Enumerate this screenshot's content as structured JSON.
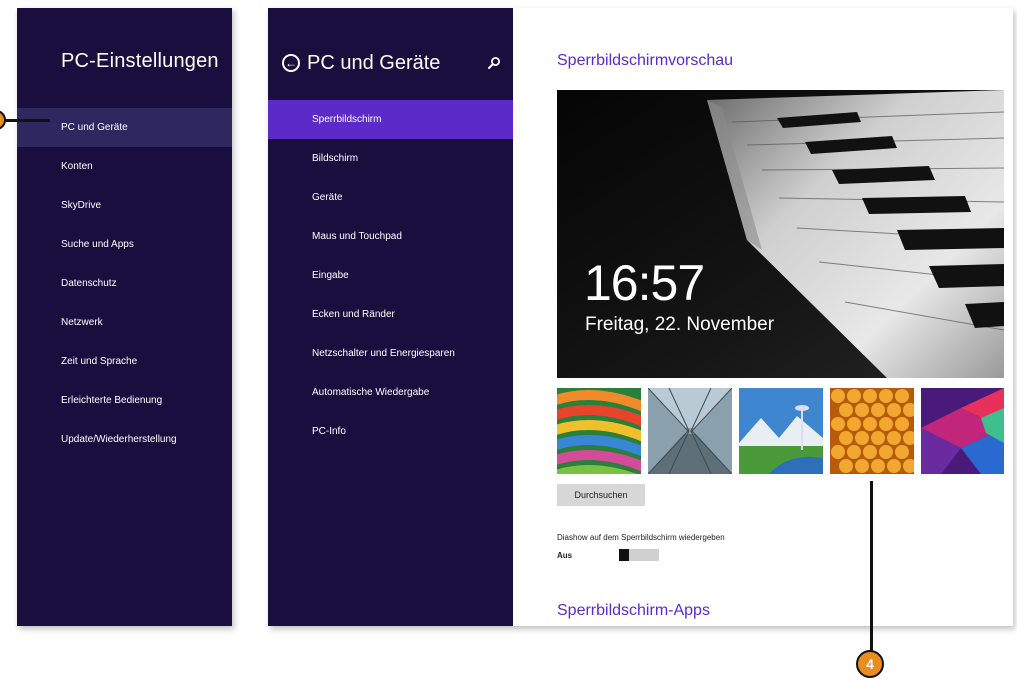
{
  "settings_panel": {
    "title": "PC-Einstellungen",
    "items": [
      {
        "label": "PC und Geräte",
        "active": true
      },
      {
        "label": "Konten"
      },
      {
        "label": "SkyDrive"
      },
      {
        "label": "Suche und Apps"
      },
      {
        "label": "Datenschutz"
      },
      {
        "label": "Netzwerk"
      },
      {
        "label": "Zeit und Sprache"
      },
      {
        "label": "Erleichterte Bedienung"
      },
      {
        "label": "Update/Wiederherstellung"
      }
    ]
  },
  "devices_panel": {
    "title": "PC und Geräte",
    "back_icon": "back-arrow-circle-icon",
    "search_icon": "search-icon",
    "items": [
      {
        "label": "Sperrbildschirm",
        "active": true
      },
      {
        "label": "Bildschirm"
      },
      {
        "label": "Geräte"
      },
      {
        "label": "Maus und Touchpad"
      },
      {
        "label": "Eingabe"
      },
      {
        "label": "Ecken und Ränder"
      },
      {
        "label": "Netzschalter und Energiesparen"
      },
      {
        "label": "Automatische Wiedergabe"
      },
      {
        "label": "PC-Info"
      }
    ]
  },
  "lockscreen": {
    "preview_heading": "Sperrbildschirmvorschau",
    "time": "16:57",
    "date": "Freitag, 22. November",
    "browse_button": "Durchsuchen",
    "slideshow_label": "Diashow auf dem Sperrbildschirm wiedergeben",
    "slideshow_state": "Aus",
    "slideshow_on": false,
    "apps_heading": "Sperrbildschirm-Apps"
  },
  "callouts": {
    "bottom_number": "4"
  },
  "colors": {
    "nav_bg": "#180f3f",
    "nav_active_settings": "#2e2760",
    "nav_active_devices": "#5b2ac9",
    "heading_accent": "#5b2ac9",
    "callout_badge": "#e88d1f"
  }
}
